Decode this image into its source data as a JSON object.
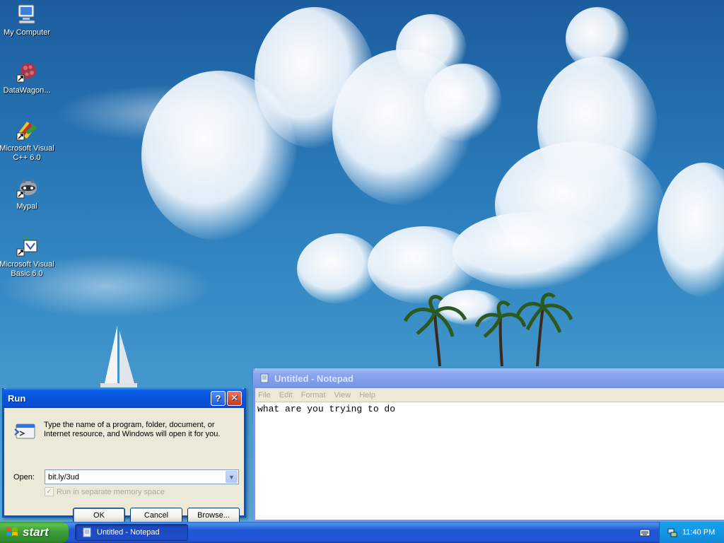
{
  "desktop": {
    "icons": [
      {
        "label": "My Computer",
        "icon": "my-computer-icon"
      },
      {
        "label": "DataWagon...",
        "icon": "datawagon-icon"
      },
      {
        "label": "Microsoft Visual\nC++ 6.0",
        "icon": "visual-cpp-icon"
      },
      {
        "label": "Mypal",
        "icon": "mypal-icon"
      },
      {
        "label": "Microsoft Visual\nBasic 6.0",
        "icon": "visual-basic-icon"
      }
    ]
  },
  "run_dialog": {
    "title": "Run",
    "description": "Type the name of a program, folder, document, or Internet resource, and Windows will open it for you.",
    "open_label": "Open:",
    "open_value": "bit.ly/3ud",
    "separate_memory_label": "Run in separate memory space",
    "help_button": "?",
    "close_button": "✕",
    "ok_label": "OK",
    "cancel_label": "Cancel",
    "browse_label": "Browse..."
  },
  "notepad": {
    "title": "Untitled - Notepad",
    "menu": [
      "File",
      "Edit",
      "Format",
      "View",
      "Help"
    ],
    "text": "what are you trying to do"
  },
  "taskbar": {
    "start_label": "start",
    "tasks": [
      {
        "label": "Untitled - Notepad",
        "icon": "notepad-icon"
      }
    ],
    "clock": "11:40 PM"
  },
  "colors": {
    "titlebar_active": "#0a4fd6",
    "titlebar_inactive": "#7f9ce8",
    "taskbar": "#2157d7",
    "start_green": "#3b9a37",
    "tray": "#1497e4"
  }
}
